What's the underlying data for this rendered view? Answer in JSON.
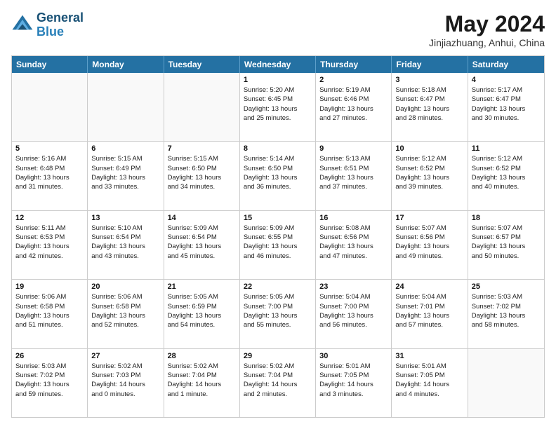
{
  "header": {
    "logo_line1": "General",
    "logo_line2": "Blue",
    "month_title": "May 2024",
    "location": "Jinjiazhuang, Anhui, China"
  },
  "days_of_week": [
    "Sunday",
    "Monday",
    "Tuesday",
    "Wednesday",
    "Thursday",
    "Friday",
    "Saturday"
  ],
  "weeks": [
    [
      {
        "day": "",
        "info": ""
      },
      {
        "day": "",
        "info": ""
      },
      {
        "day": "",
        "info": ""
      },
      {
        "day": "1",
        "info": "Sunrise: 5:20 AM\nSunset: 6:45 PM\nDaylight: 13 hours\nand 25 minutes."
      },
      {
        "day": "2",
        "info": "Sunrise: 5:19 AM\nSunset: 6:46 PM\nDaylight: 13 hours\nand 27 minutes."
      },
      {
        "day": "3",
        "info": "Sunrise: 5:18 AM\nSunset: 6:47 PM\nDaylight: 13 hours\nand 28 minutes."
      },
      {
        "day": "4",
        "info": "Sunrise: 5:17 AM\nSunset: 6:47 PM\nDaylight: 13 hours\nand 30 minutes."
      }
    ],
    [
      {
        "day": "5",
        "info": "Sunrise: 5:16 AM\nSunset: 6:48 PM\nDaylight: 13 hours\nand 31 minutes."
      },
      {
        "day": "6",
        "info": "Sunrise: 5:15 AM\nSunset: 6:49 PM\nDaylight: 13 hours\nand 33 minutes."
      },
      {
        "day": "7",
        "info": "Sunrise: 5:15 AM\nSunset: 6:50 PM\nDaylight: 13 hours\nand 34 minutes."
      },
      {
        "day": "8",
        "info": "Sunrise: 5:14 AM\nSunset: 6:50 PM\nDaylight: 13 hours\nand 36 minutes."
      },
      {
        "day": "9",
        "info": "Sunrise: 5:13 AM\nSunset: 6:51 PM\nDaylight: 13 hours\nand 37 minutes."
      },
      {
        "day": "10",
        "info": "Sunrise: 5:12 AM\nSunset: 6:52 PM\nDaylight: 13 hours\nand 39 minutes."
      },
      {
        "day": "11",
        "info": "Sunrise: 5:12 AM\nSunset: 6:52 PM\nDaylight: 13 hours\nand 40 minutes."
      }
    ],
    [
      {
        "day": "12",
        "info": "Sunrise: 5:11 AM\nSunset: 6:53 PM\nDaylight: 13 hours\nand 42 minutes."
      },
      {
        "day": "13",
        "info": "Sunrise: 5:10 AM\nSunset: 6:54 PM\nDaylight: 13 hours\nand 43 minutes."
      },
      {
        "day": "14",
        "info": "Sunrise: 5:09 AM\nSunset: 6:54 PM\nDaylight: 13 hours\nand 45 minutes."
      },
      {
        "day": "15",
        "info": "Sunrise: 5:09 AM\nSunset: 6:55 PM\nDaylight: 13 hours\nand 46 minutes."
      },
      {
        "day": "16",
        "info": "Sunrise: 5:08 AM\nSunset: 6:56 PM\nDaylight: 13 hours\nand 47 minutes."
      },
      {
        "day": "17",
        "info": "Sunrise: 5:07 AM\nSunset: 6:56 PM\nDaylight: 13 hours\nand 49 minutes."
      },
      {
        "day": "18",
        "info": "Sunrise: 5:07 AM\nSunset: 6:57 PM\nDaylight: 13 hours\nand 50 minutes."
      }
    ],
    [
      {
        "day": "19",
        "info": "Sunrise: 5:06 AM\nSunset: 6:58 PM\nDaylight: 13 hours\nand 51 minutes."
      },
      {
        "day": "20",
        "info": "Sunrise: 5:06 AM\nSunset: 6:58 PM\nDaylight: 13 hours\nand 52 minutes."
      },
      {
        "day": "21",
        "info": "Sunrise: 5:05 AM\nSunset: 6:59 PM\nDaylight: 13 hours\nand 54 minutes."
      },
      {
        "day": "22",
        "info": "Sunrise: 5:05 AM\nSunset: 7:00 PM\nDaylight: 13 hours\nand 55 minutes."
      },
      {
        "day": "23",
        "info": "Sunrise: 5:04 AM\nSunset: 7:00 PM\nDaylight: 13 hours\nand 56 minutes."
      },
      {
        "day": "24",
        "info": "Sunrise: 5:04 AM\nSunset: 7:01 PM\nDaylight: 13 hours\nand 57 minutes."
      },
      {
        "day": "25",
        "info": "Sunrise: 5:03 AM\nSunset: 7:02 PM\nDaylight: 13 hours\nand 58 minutes."
      }
    ],
    [
      {
        "day": "26",
        "info": "Sunrise: 5:03 AM\nSunset: 7:02 PM\nDaylight: 13 hours\nand 59 minutes."
      },
      {
        "day": "27",
        "info": "Sunrise: 5:02 AM\nSunset: 7:03 PM\nDaylight: 14 hours\nand 0 minutes."
      },
      {
        "day": "28",
        "info": "Sunrise: 5:02 AM\nSunset: 7:04 PM\nDaylight: 14 hours\nand 1 minute."
      },
      {
        "day": "29",
        "info": "Sunrise: 5:02 AM\nSunset: 7:04 PM\nDaylight: 14 hours\nand 2 minutes."
      },
      {
        "day": "30",
        "info": "Sunrise: 5:01 AM\nSunset: 7:05 PM\nDaylight: 14 hours\nand 3 minutes."
      },
      {
        "day": "31",
        "info": "Sunrise: 5:01 AM\nSunset: 7:05 PM\nDaylight: 14 hours\nand 4 minutes."
      },
      {
        "day": "",
        "info": ""
      }
    ]
  ]
}
